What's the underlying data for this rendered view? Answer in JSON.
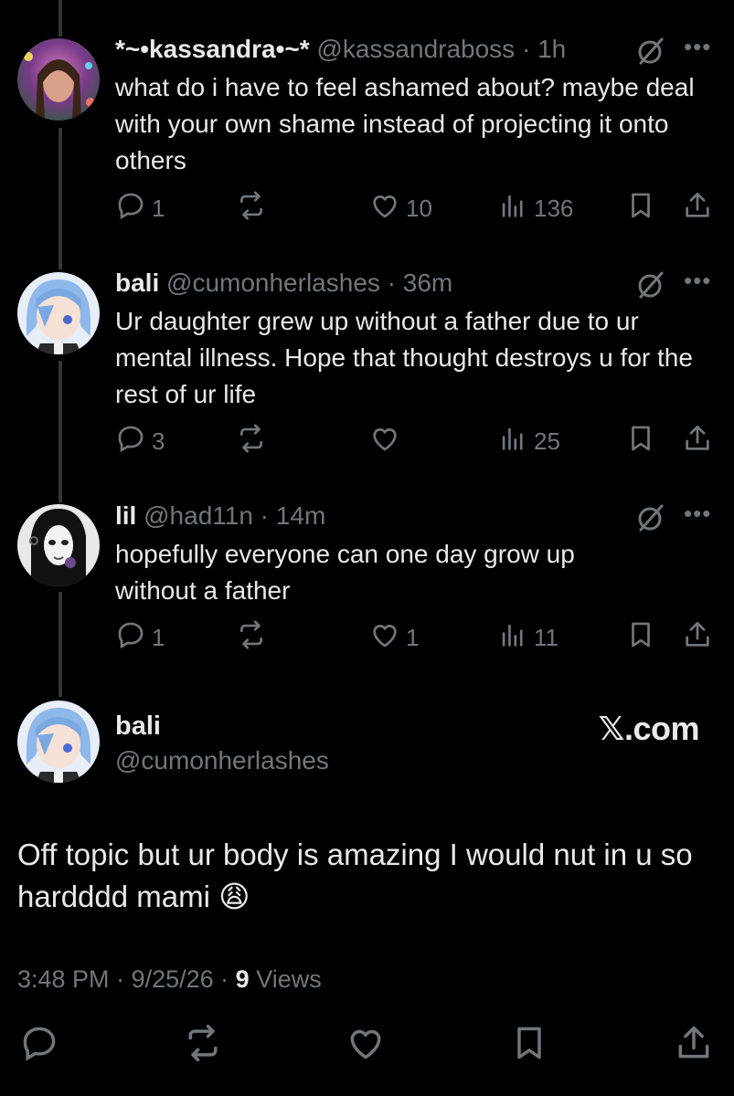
{
  "tweets": [
    {
      "name": "*~•kassandra•~*",
      "handle": "@kassandraboss",
      "time": "1h",
      "text": "what do i have to feel ashamed about? maybe deal with your own shame instead of projecting it onto others",
      "replies": "1",
      "reposts": "",
      "likes": "10",
      "views": "136"
    },
    {
      "name": "bali",
      "handle": "@cumonherlashes",
      "time": "36m",
      "text": "Ur daughter grew up without a father due to ur mental illness. Hope that thought destroys u for the rest of ur life",
      "replies": "3",
      "reposts": "",
      "likes": "",
      "views": "25"
    },
    {
      "name": "lil",
      "handle": "@had11n",
      "time": "14m",
      "text": "hopefully everyone can one day grow up without a father",
      "replies": "1",
      "reposts": "",
      "likes": "1",
      "views": "11"
    }
  ],
  "focus": {
    "name": "bali",
    "handle": "@cumonherlashes",
    "brand": "𝕏.com",
    "text": "Off topic but ur body is amazing I would nut in u so hardddd mami 😩",
    "time": "3:48 PM",
    "date": "9/25/26",
    "views_count": "9",
    "views_label": "Views"
  },
  "icons": [
    "reply-icon",
    "repost-icon",
    "like-icon",
    "views-icon",
    "bookmark-icon",
    "share-icon",
    "grok-icon",
    "more-icon"
  ],
  "colors": {
    "background": "#000000",
    "text": "#e7e9ea",
    "muted": "#71767b",
    "thread_line": "#333639"
  }
}
